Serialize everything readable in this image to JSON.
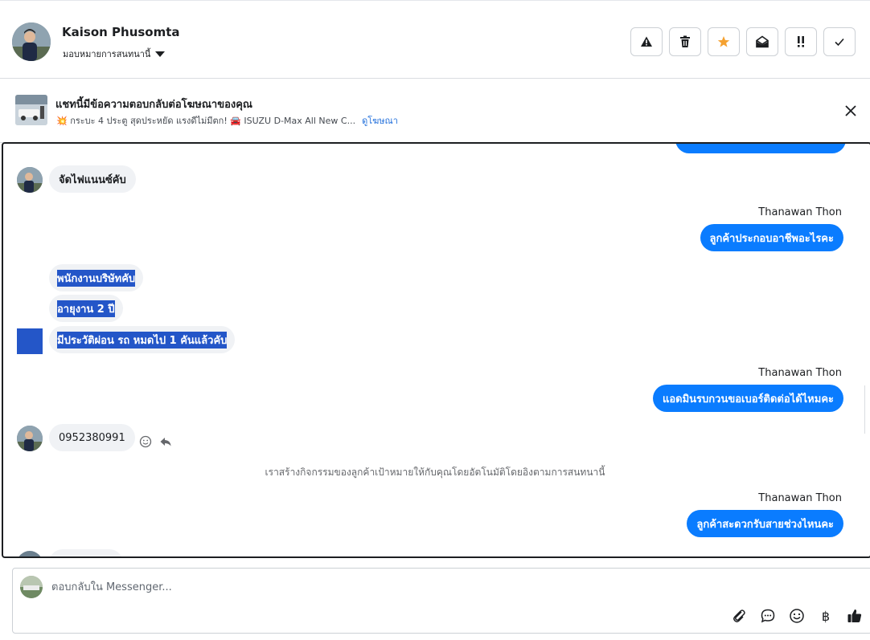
{
  "header": {
    "contact_name": "Kaison Phusomta",
    "assign_label": "มอบหมายการสนทนานี้",
    "actions": [
      {
        "name": "report-spam",
        "icon": "warning-icon"
      },
      {
        "name": "delete",
        "icon": "trash-icon"
      },
      {
        "name": "star",
        "icon": "star-icon"
      },
      {
        "name": "mark-unread",
        "icon": "envelope-open-icon"
      },
      {
        "name": "follow-up",
        "icon": "double-exclamation-icon"
      },
      {
        "name": "mark-done",
        "icon": "check-icon"
      }
    ],
    "star_color": "#f5a130"
  },
  "ad_banner": {
    "title": "แชทนี้มีข้อความตอบกลับต่อโฆษณาของคุณ",
    "subtitle": "💥 กระบะ 4 ประตู สุดประหยัด แรงดีไม่มีตก! 🚘 ISUZU D-Max All New C...",
    "link": "ดูโฆษณา"
  },
  "messages": {
    "m1_text": "จัดไฟแนนซ์คับ",
    "sender1": "Thanawan Thon",
    "o1_text": "ลูกค้าประกอบอาชีพอะไรคะ",
    "m2_text": "พนักงานบริษัทคับ",
    "m3_text": "อายุงาน 2 ปี",
    "m4_text": "มีประวัติผ่อน รถ หมดไป 1 คันแล้วคับ",
    "sender2": "Thanawan Thon",
    "o2_text": "แอดมินรบกวนขอเบอร์ติดต่อได้ไหมคะ",
    "m5_text": "0952380991",
    "system_note": "เราสร้างกิจกรรมของลูกค้าเป้าหมายให้กับคุณโดยอัตโนมัติโดยอิงตามการสนทนานี้",
    "sender3": "Thanawan Thon",
    "o3_text": "ลูกค้าสะดวกรับสายช่วงไหนคะ"
  },
  "composer": {
    "placeholder": "ตอบกลับใน Messenger...",
    "tools": [
      "paperclip-icon",
      "chat-bubble-icon",
      "emoji-icon",
      "baht-icon",
      "thumbs-up-icon"
    ],
    "baht_symbol": "฿"
  },
  "colors": {
    "outgoing_bubble": "#0a7cff",
    "incoming_bubble": "#f0f2f5",
    "selection": "#2456c8",
    "link": "#216fdb"
  }
}
